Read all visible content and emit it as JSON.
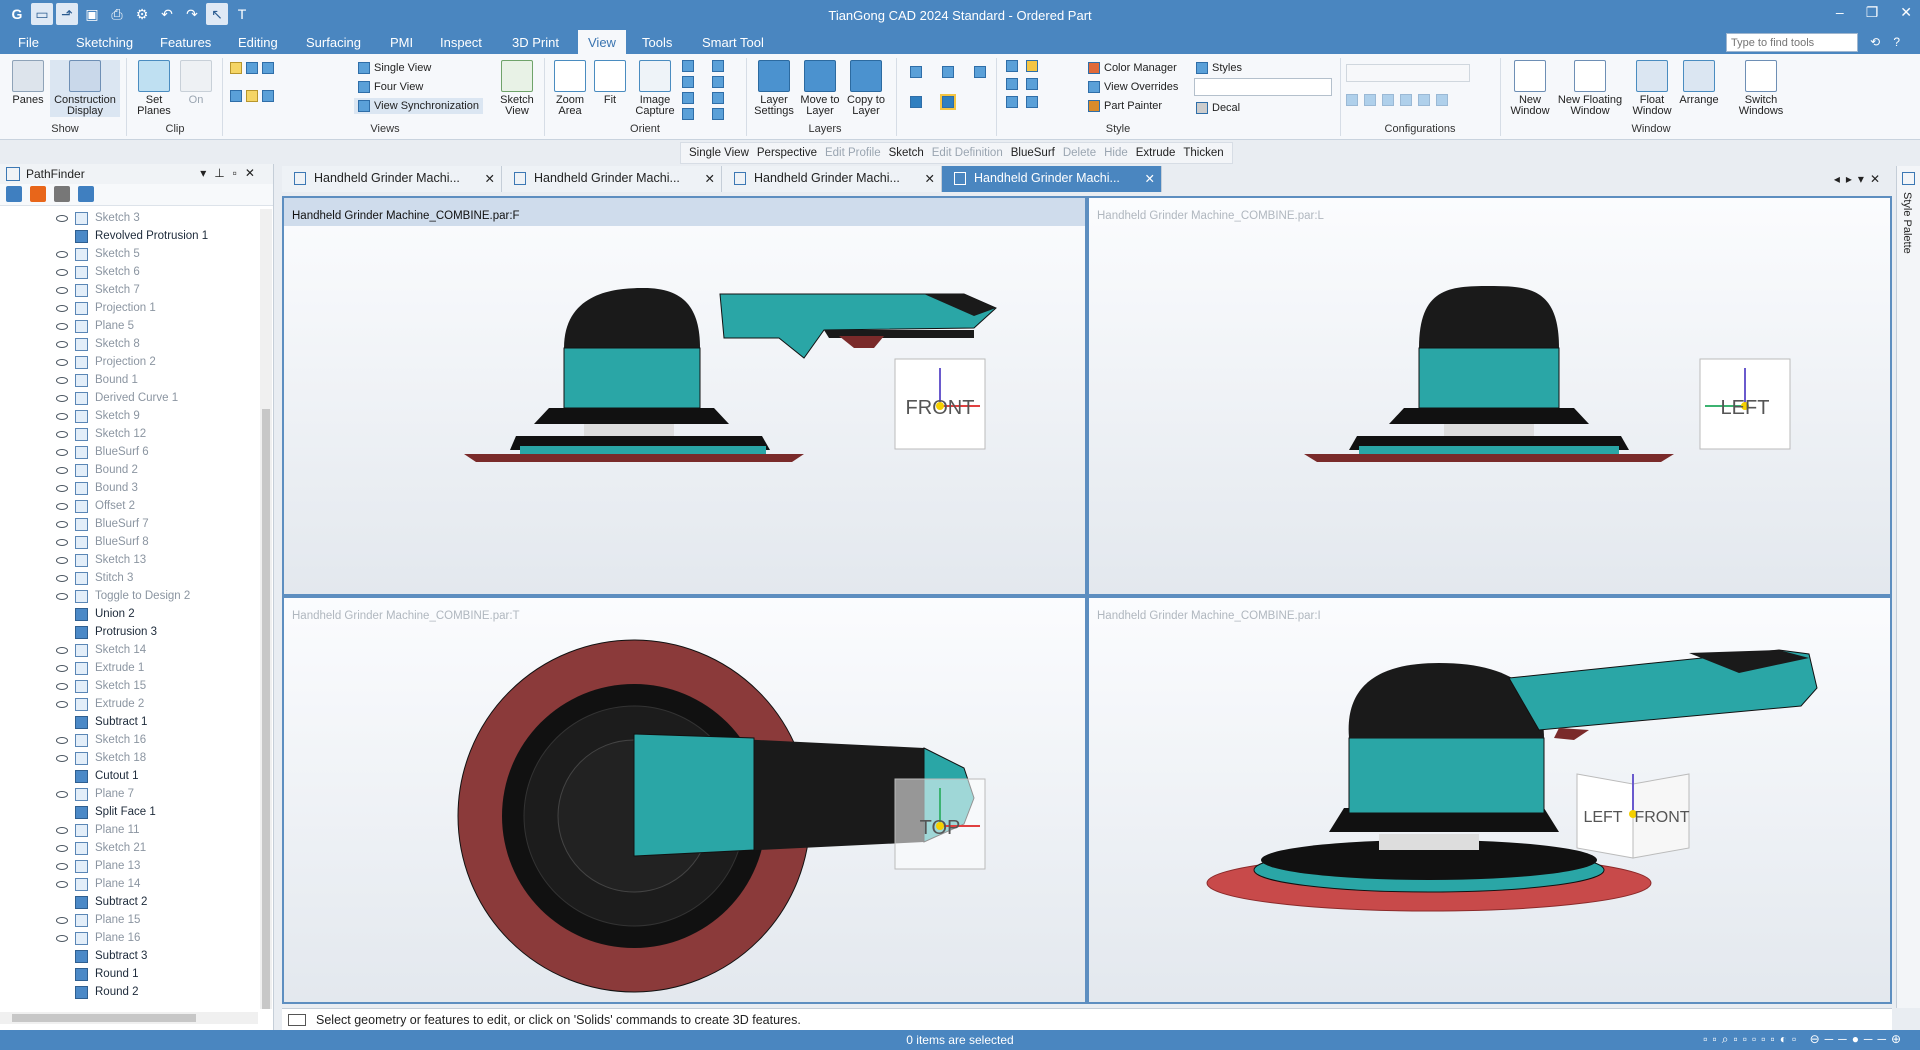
{
  "window": {
    "title": "TianGong CAD 2024 Standard - Ordered Part"
  },
  "menu": {
    "file": "File",
    "tabs": [
      "Sketching",
      "Features",
      "Editing",
      "Surfacing",
      "PMI",
      "Inspect",
      "3D Print",
      "View",
      "Tools",
      "Smart Tool"
    ],
    "active": "View",
    "search_placeholder": "Type to find tools"
  },
  "ribbon": {
    "show": {
      "panes": "Panes",
      "construction": "Construction Display",
      "group": "Show"
    },
    "clip": {
      "set_planes": "Set Planes",
      "on": "On",
      "group": "Clip"
    },
    "views": {
      "single": "Single View",
      "four": "Four View",
      "sync": "View Synchronization",
      "sketch_view": "Sketch View",
      "group": "Views"
    },
    "orient": {
      "zoom_area": "Zoom Area",
      "fit": "Fit",
      "image_capture": "Image Capture",
      "group": "Orient"
    },
    "layers": {
      "layer_settings": "Layer Settings",
      "move_to_layer": "Move to Layer",
      "copy_to_layer": "Copy to Layer",
      "group": "Layers"
    },
    "style": {
      "color_manager": "Color Manager",
      "view_overrides": "View Overrides",
      "part_painter": "Part Painter",
      "styles": "Styles",
      "decal": "Decal",
      "group": "Style"
    },
    "configurations": {
      "group": "Configurations"
    },
    "window": {
      "new_window": "New Window",
      "new_floating": "New Floating Window",
      "float_window": "Float Window",
      "arrange": "Arrange",
      "switch_windows": "Switch Windows",
      "group": "Window"
    }
  },
  "command_bar": [
    "Single View",
    "Perspective",
    "Edit Profile",
    "Sketch",
    "Edit Definition",
    "BlueSurf",
    "Delete",
    "Hide",
    "Extrude",
    "Thicken"
  ],
  "pathfinder": {
    "title": "PathFinder",
    "items": [
      {
        "label": "Sketch 3",
        "active": false
      },
      {
        "label": "Revolved Protrusion 1",
        "active": true
      },
      {
        "label": "Sketch 5",
        "active": false
      },
      {
        "label": "Sketch 6",
        "active": false
      },
      {
        "label": "Sketch 7",
        "active": false
      },
      {
        "label": "Projection 1",
        "active": false
      },
      {
        "label": "Plane 5",
        "active": false
      },
      {
        "label": "Sketch 8",
        "active": false
      },
      {
        "label": "Projection 2",
        "active": false
      },
      {
        "label": "Bound 1",
        "active": false
      },
      {
        "label": "Derived Curve 1",
        "active": false
      },
      {
        "label": "Sketch 9",
        "active": false
      },
      {
        "label": "Sketch 12",
        "active": false
      },
      {
        "label": "BlueSurf 6",
        "active": false
      },
      {
        "label": "Bound 2",
        "active": false
      },
      {
        "label": "Bound 3",
        "active": false
      },
      {
        "label": "Offset 2",
        "active": false
      },
      {
        "label": "BlueSurf 7",
        "active": false
      },
      {
        "label": "BlueSurf 8",
        "active": false
      },
      {
        "label": "Sketch 13",
        "active": false
      },
      {
        "label": "Stitch 3",
        "active": false
      },
      {
        "label": "Toggle to Design 2",
        "active": false
      },
      {
        "label": "Union 2",
        "active": true
      },
      {
        "label": "Protrusion 3",
        "active": true
      },
      {
        "label": "Sketch 14",
        "active": false
      },
      {
        "label": "Extrude 1",
        "active": false
      },
      {
        "label": "Sketch 15",
        "active": false
      },
      {
        "label": "Extrude 2",
        "active": false
      },
      {
        "label": "Subtract 1",
        "active": true
      },
      {
        "label": "Sketch 16",
        "active": false
      },
      {
        "label": "Sketch 18",
        "active": false
      },
      {
        "label": "Cutout 1",
        "active": true
      },
      {
        "label": "Plane 7",
        "active": false
      },
      {
        "label": "Split Face 1",
        "active": true
      },
      {
        "label": "Plane 11",
        "active": false
      },
      {
        "label": "Sketch 21",
        "active": false
      },
      {
        "label": "Plane 13",
        "active": false
      },
      {
        "label": "Plane 14",
        "active": false
      },
      {
        "label": "Subtract 2",
        "active": true
      },
      {
        "label": "Plane 15",
        "active": false
      },
      {
        "label": "Plane 16",
        "active": false
      },
      {
        "label": "Subtract 3",
        "active": true
      },
      {
        "label": "Round 1",
        "active": true
      },
      {
        "label": "Round 2",
        "active": true
      }
    ]
  },
  "doc_tabs": [
    "Handheld Grinder Machi...",
    "Handheld Grinder Machi...",
    "Handheld Grinder Machi...",
    "Handheld Grinder Machi..."
  ],
  "viewports": [
    {
      "label": "Handheld Grinder Machine_COMBINE.par:F",
      "cube": "FRONT"
    },
    {
      "label": "Handheld Grinder Machine_COMBINE.par:L",
      "cube": "LEFT"
    },
    {
      "label": "Handheld Grinder Machine_COMBINE.par:T",
      "cube": "TOP"
    },
    {
      "label": "Handheld Grinder Machine_COMBINE.par:I",
      "cube_left": "LEFT",
      "cube_front": "FRONT"
    }
  ],
  "style_palette": "Style Palette",
  "status": {
    "prompt": "Select geometry or features to edit, or click on 'Solids' commands to create 3D features.",
    "selection": "0 items are selected"
  },
  "colors": {
    "teal": "#2aa6a6",
    "black": "#1a1a1a",
    "pad": "#8b3a3a",
    "accent": "#4a86c0"
  }
}
